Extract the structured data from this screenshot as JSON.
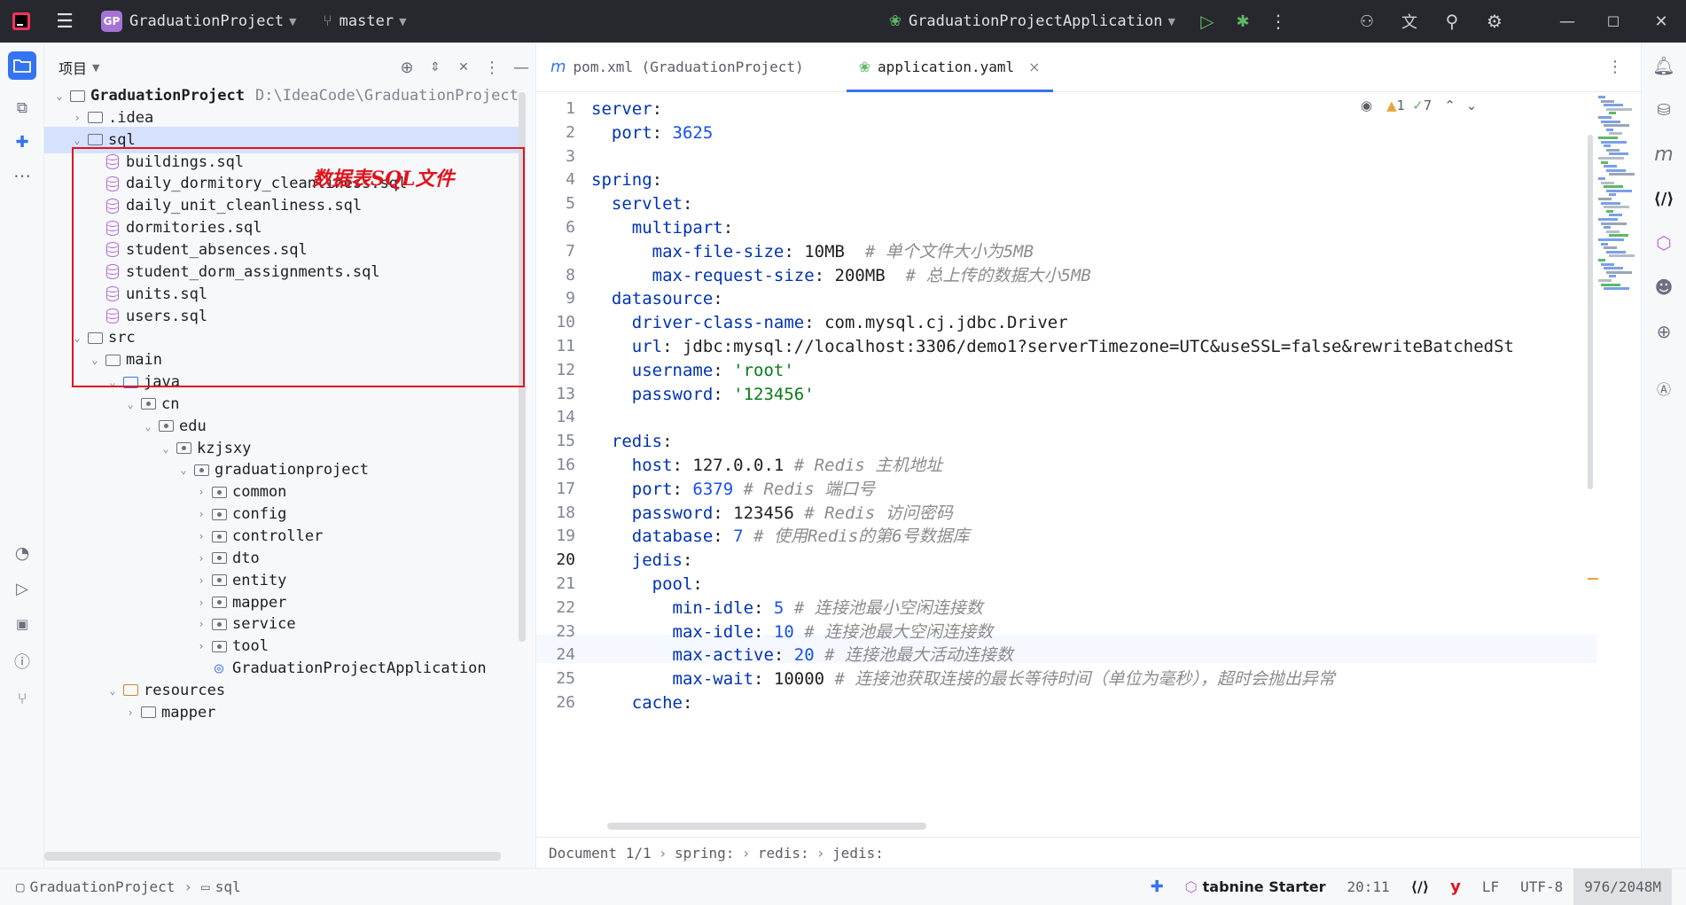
{
  "titlebar": {
    "project_badge": "GP",
    "project_name": "GraduationProject",
    "branch": "master",
    "run_config": "GraduationProjectApplication"
  },
  "project_panel": {
    "title": "项目",
    "annotation": "数据表SQL文件",
    "tree": [
      {
        "label": "GraduationProject",
        "path": "D:\\IdeaCode\\GraduationProject",
        "bold": true
      },
      {
        "label": ".idea"
      },
      {
        "label": "sql"
      },
      {
        "label": "buildings.sql"
      },
      {
        "label": "daily_dormitory_cleanliness.sql"
      },
      {
        "label": "daily_unit_cleanliness.sql"
      },
      {
        "label": "dormitories.sql"
      },
      {
        "label": "student_absences.sql"
      },
      {
        "label": "student_dorm_assignments.sql"
      },
      {
        "label": "units.sql"
      },
      {
        "label": "users.sql"
      },
      {
        "label": "src"
      },
      {
        "label": "main"
      },
      {
        "label": "java"
      },
      {
        "label": "cn"
      },
      {
        "label": "edu"
      },
      {
        "label": "kzjsxy"
      },
      {
        "label": "graduationproject"
      },
      {
        "label": "common"
      },
      {
        "label": "config"
      },
      {
        "label": "controller"
      },
      {
        "label": "dto"
      },
      {
        "label": "entity"
      },
      {
        "label": "mapper"
      },
      {
        "label": "service"
      },
      {
        "label": "tool"
      },
      {
        "label": "GraduationProjectApplication"
      },
      {
        "label": "resources"
      },
      {
        "label": "mapper"
      }
    ]
  },
  "editor": {
    "tabs": [
      {
        "icon": "m",
        "label": "pom.xml (GraduationProject)"
      },
      {
        "label": "application.yaml",
        "close": "×"
      }
    ],
    "inspections": {
      "warnings": "1",
      "ok": "7"
    },
    "lines": [
      {
        "no": "1",
        "parts": [
          [
            "k",
            "server"
          ],
          [
            "v",
            ":"
          ]
        ]
      },
      {
        "no": "2",
        "parts": [
          [
            "k",
            "  port"
          ],
          [
            "v",
            ": "
          ],
          [
            "n",
            "3625"
          ]
        ]
      },
      {
        "no": "3",
        "parts": []
      },
      {
        "no": "4",
        "parts": [
          [
            "k",
            "spring"
          ],
          [
            "v",
            ":"
          ]
        ]
      },
      {
        "no": "5",
        "parts": [
          [
            "k",
            "  servlet"
          ],
          [
            "v",
            ":"
          ]
        ]
      },
      {
        "no": "6",
        "parts": [
          [
            "k",
            "    multipart"
          ],
          [
            "v",
            ":"
          ]
        ]
      },
      {
        "no": "7",
        "parts": [
          [
            "k",
            "      max-file-size"
          ],
          [
            "v",
            ": 10MB  "
          ],
          [
            "c",
            "# 单个文件大小为5MB"
          ]
        ]
      },
      {
        "no": "8",
        "parts": [
          [
            "k",
            "      max-request-size"
          ],
          [
            "v",
            ": 200MB  "
          ],
          [
            "c",
            "# 总上传的数据大小5MB"
          ]
        ]
      },
      {
        "no": "9",
        "parts": [
          [
            "k",
            "  datasource"
          ],
          [
            "v",
            ":"
          ]
        ]
      },
      {
        "no": "10",
        "parts": [
          [
            "k",
            "    driver-class-name"
          ],
          [
            "v",
            ": com.mysql.cj.jdbc.Driver"
          ]
        ]
      },
      {
        "no": "11",
        "parts": [
          [
            "k",
            "    url"
          ],
          [
            "v",
            ": jdbc:mysql://localhost:3306/demo1?serverTimezone=UTC&useSSL=false&rewriteBatchedSt"
          ]
        ]
      },
      {
        "no": "12",
        "parts": [
          [
            "k",
            "    username"
          ],
          [
            "v",
            ": "
          ],
          [
            "s",
            "'root'"
          ]
        ]
      },
      {
        "no": "13",
        "parts": [
          [
            "k",
            "    password"
          ],
          [
            "v",
            ": "
          ],
          [
            "s",
            "'123456'"
          ]
        ]
      },
      {
        "no": "14",
        "parts": []
      },
      {
        "no": "15",
        "parts": [
          [
            "k",
            "  redis"
          ],
          [
            "v",
            ":"
          ]
        ]
      },
      {
        "no": "16",
        "parts": [
          [
            "k",
            "    host"
          ],
          [
            "v",
            ": 127.0.0.1 "
          ],
          [
            "c",
            "# Redis 主机地址"
          ]
        ]
      },
      {
        "no": "17",
        "parts": [
          [
            "k",
            "    port"
          ],
          [
            "v",
            ": "
          ],
          [
            "n",
            "6379"
          ],
          [
            "v",
            " "
          ],
          [
            "c",
            "# Redis 端口号"
          ]
        ]
      },
      {
        "no": "18",
        "parts": [
          [
            "k",
            "    password"
          ],
          [
            "v",
            ": 123456 "
          ],
          [
            "c",
            "# Redis 访问密码"
          ]
        ]
      },
      {
        "no": "19",
        "parts": [
          [
            "k",
            "    database"
          ],
          [
            "v",
            ": "
          ],
          [
            "n",
            "7"
          ],
          [
            "v",
            " "
          ],
          [
            "c",
            "# 使用Redis的第6号数据库"
          ]
        ]
      },
      {
        "no": "20",
        "parts": [
          [
            "k",
            "    jedis"
          ],
          [
            "v",
            ":"
          ]
        ]
      },
      {
        "no": "21",
        "parts": [
          [
            "k",
            "      pool"
          ],
          [
            "v",
            ":"
          ]
        ]
      },
      {
        "no": "22",
        "parts": [
          [
            "k",
            "        min-idle"
          ],
          [
            "v",
            ": "
          ],
          [
            "n",
            "5"
          ],
          [
            "v",
            " "
          ],
          [
            "c",
            "# 连接池最小空闲连接数"
          ]
        ]
      },
      {
        "no": "23",
        "parts": [
          [
            "k",
            "        max-idle"
          ],
          [
            "v",
            ": "
          ],
          [
            "n",
            "10"
          ],
          [
            "v",
            " "
          ],
          [
            "c",
            "# 连接池最大空闲连接数"
          ]
        ]
      },
      {
        "no": "24",
        "parts": [
          [
            "k",
            "        max-active"
          ],
          [
            "v",
            ": "
          ],
          [
            "n",
            "20"
          ],
          [
            "v",
            " "
          ],
          [
            "c",
            "# 连接池最大活动连接数"
          ]
        ]
      },
      {
        "no": "25",
        "parts": [
          [
            "k",
            "        max-wait"
          ],
          [
            "v",
            ": 10000 "
          ],
          [
            "c",
            "# 连接池获取连接的最长等待时间（单位为毫秒），超时会抛出异常"
          ]
        ]
      },
      {
        "no": "26",
        "parts": [
          [
            "k",
            "    cache"
          ],
          [
            "v",
            ":"
          ]
        ]
      }
    ],
    "breadcrumb": [
      "Document 1/1",
      "spring:",
      "redis:",
      "jedis:"
    ]
  },
  "statusbar": {
    "path": [
      "GraduationProject",
      "sql"
    ],
    "tabnine": "tabnine Starter",
    "position": "20:11",
    "line_sep": "LF",
    "encoding": "UTF-8",
    "memory": "976/2048M"
  }
}
